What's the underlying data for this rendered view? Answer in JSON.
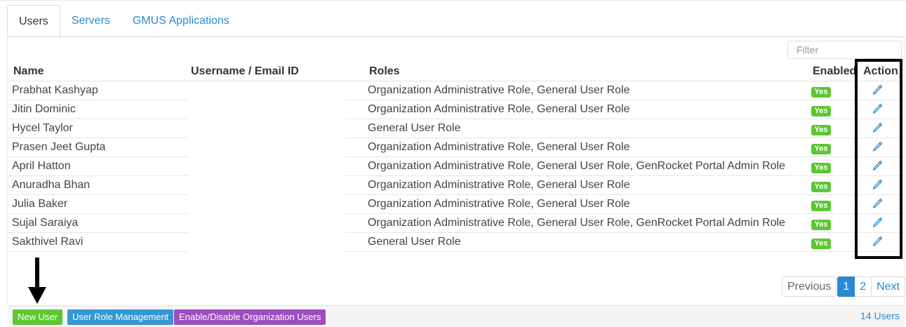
{
  "tabs": [
    {
      "label": "Users",
      "active": true
    },
    {
      "label": "Servers",
      "active": false
    },
    {
      "label": "GMUS Applications",
      "active": false
    }
  ],
  "filter": {
    "placeholder": "Filter",
    "value": ""
  },
  "table": {
    "headers": {
      "name": "Name",
      "username": "Username / Email ID",
      "roles": "Roles",
      "enabled": "Enabled",
      "action": "Action"
    },
    "rows": [
      {
        "name": "Prabhat Kashyap",
        "username": "",
        "roles": "Organization Administrative Role, General User Role",
        "enabled": "Yes"
      },
      {
        "name": "Jitin Dominic",
        "username": "",
        "roles": "Organization Administrative Role, General User Role",
        "enabled": "Yes"
      },
      {
        "name": "Hycel Taylor",
        "username": "",
        "roles": "General User Role",
        "enabled": "Yes"
      },
      {
        "name": "Prasen Jeet Gupta",
        "username": "",
        "roles": "Organization Administrative Role, General User Role",
        "enabled": "Yes"
      },
      {
        "name": "April Hatton",
        "username": "",
        "roles": "Organization Administrative Role, General User Role, GenRocket Portal Admin Role",
        "enabled": "Yes"
      },
      {
        "name": "Anuradha Bhan",
        "username": "",
        "roles": "Organization Administrative Role, General User Role",
        "enabled": "Yes"
      },
      {
        "name": "Julia Baker",
        "username": "",
        "roles": "Organization Administrative Role, General User Role",
        "enabled": "Yes"
      },
      {
        "name": "Sujal Saraiya",
        "username": "",
        "roles": "Organization Administrative Role, General User Role, GenRocket Portal Admin Role",
        "enabled": "Yes"
      },
      {
        "name": "Sakthivel Ravi",
        "username": "",
        "roles": "General User Role",
        "enabled": "Yes"
      }
    ]
  },
  "pagination": {
    "previous": "Previous",
    "pages": [
      "1",
      "2"
    ],
    "current": "1",
    "next": "Next"
  },
  "footer": {
    "new_user": "New User",
    "user_role_management": "User Role Management",
    "enable_disable": "Enable/Disable Organization Users",
    "count": "14 Users"
  },
  "colors": {
    "accent": "#2a8ad1",
    "enabled_badge": "#5cc732",
    "new_user_button": "#5cc732",
    "role_mgmt_button": "#3597d3",
    "enable_disable_button": "#9c4dbf"
  },
  "icons": {
    "edit": "pencil-icon",
    "annotation": "down-arrow-annotation"
  }
}
